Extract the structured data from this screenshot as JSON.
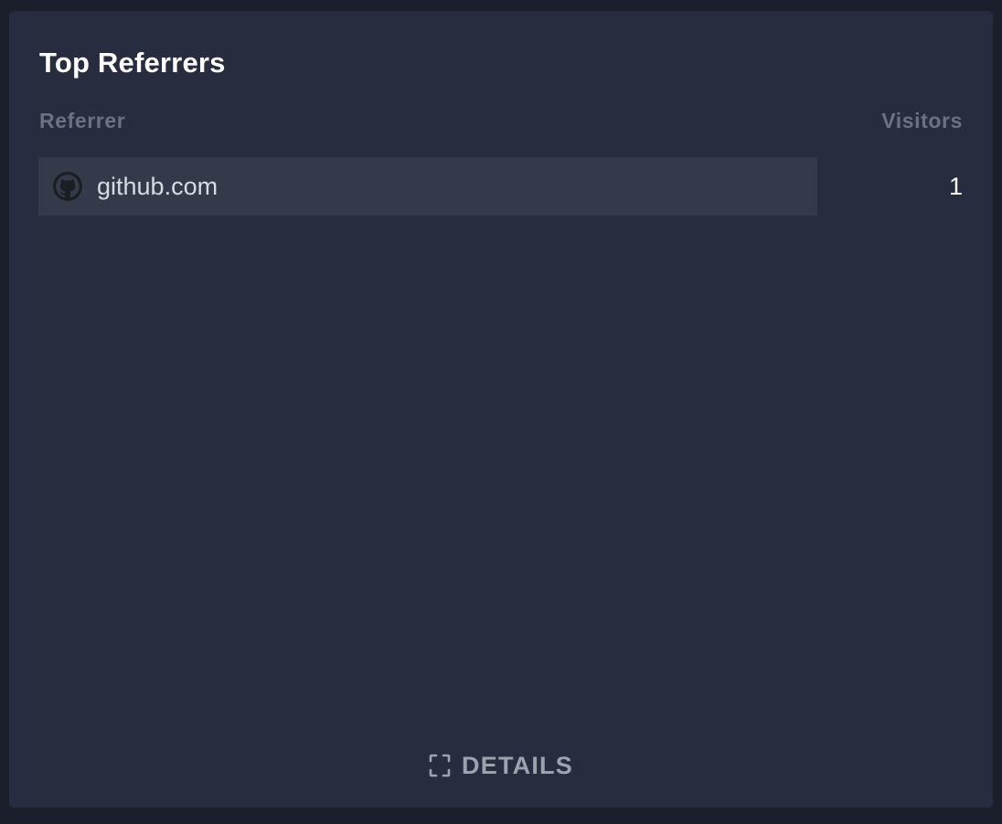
{
  "card": {
    "title": "Top Referrers",
    "columns": {
      "referrer": "Referrer",
      "visitors": "Visitors"
    },
    "rows": [
      {
        "icon": "github-icon",
        "label": "github.com",
        "value": "1",
        "bar_fraction": 1.0
      }
    ],
    "footer": {
      "details_icon": "expand-icon",
      "details_label": "DETAILS"
    }
  },
  "colors": {
    "background": "#1a1f2b",
    "card": "#272d3e",
    "row_bar": "#343a4a",
    "header_text": "#6b7280",
    "footer_text": "#9ca3af"
  }
}
